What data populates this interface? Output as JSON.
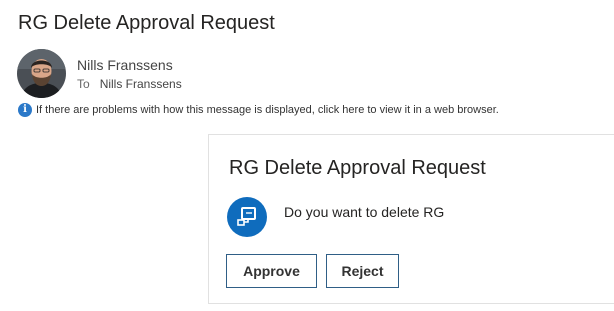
{
  "email": {
    "subject": "RG Delete Approval Request",
    "sender": {
      "name": "Nills Franssens",
      "avatar": "sender-avatar-photo"
    },
    "to_label": "To",
    "recipient": "Nills Franssens",
    "info_bar": {
      "icon": "info-icon",
      "text": "If there are problems with how this message is displayed, click here to view it in a web browser."
    }
  },
  "card": {
    "title": "RG Delete Approval Request",
    "icon": "power-automate-flow-icon",
    "message": "Do you want to delete RG",
    "actions": {
      "approve_label": "Approve",
      "reject_label": "Reject"
    }
  },
  "colors": {
    "accent_blue": "#0f6cbd",
    "info_blue": "#2b79c9",
    "button_border": "#2f5e86",
    "card_border": "#e1e1e1"
  }
}
